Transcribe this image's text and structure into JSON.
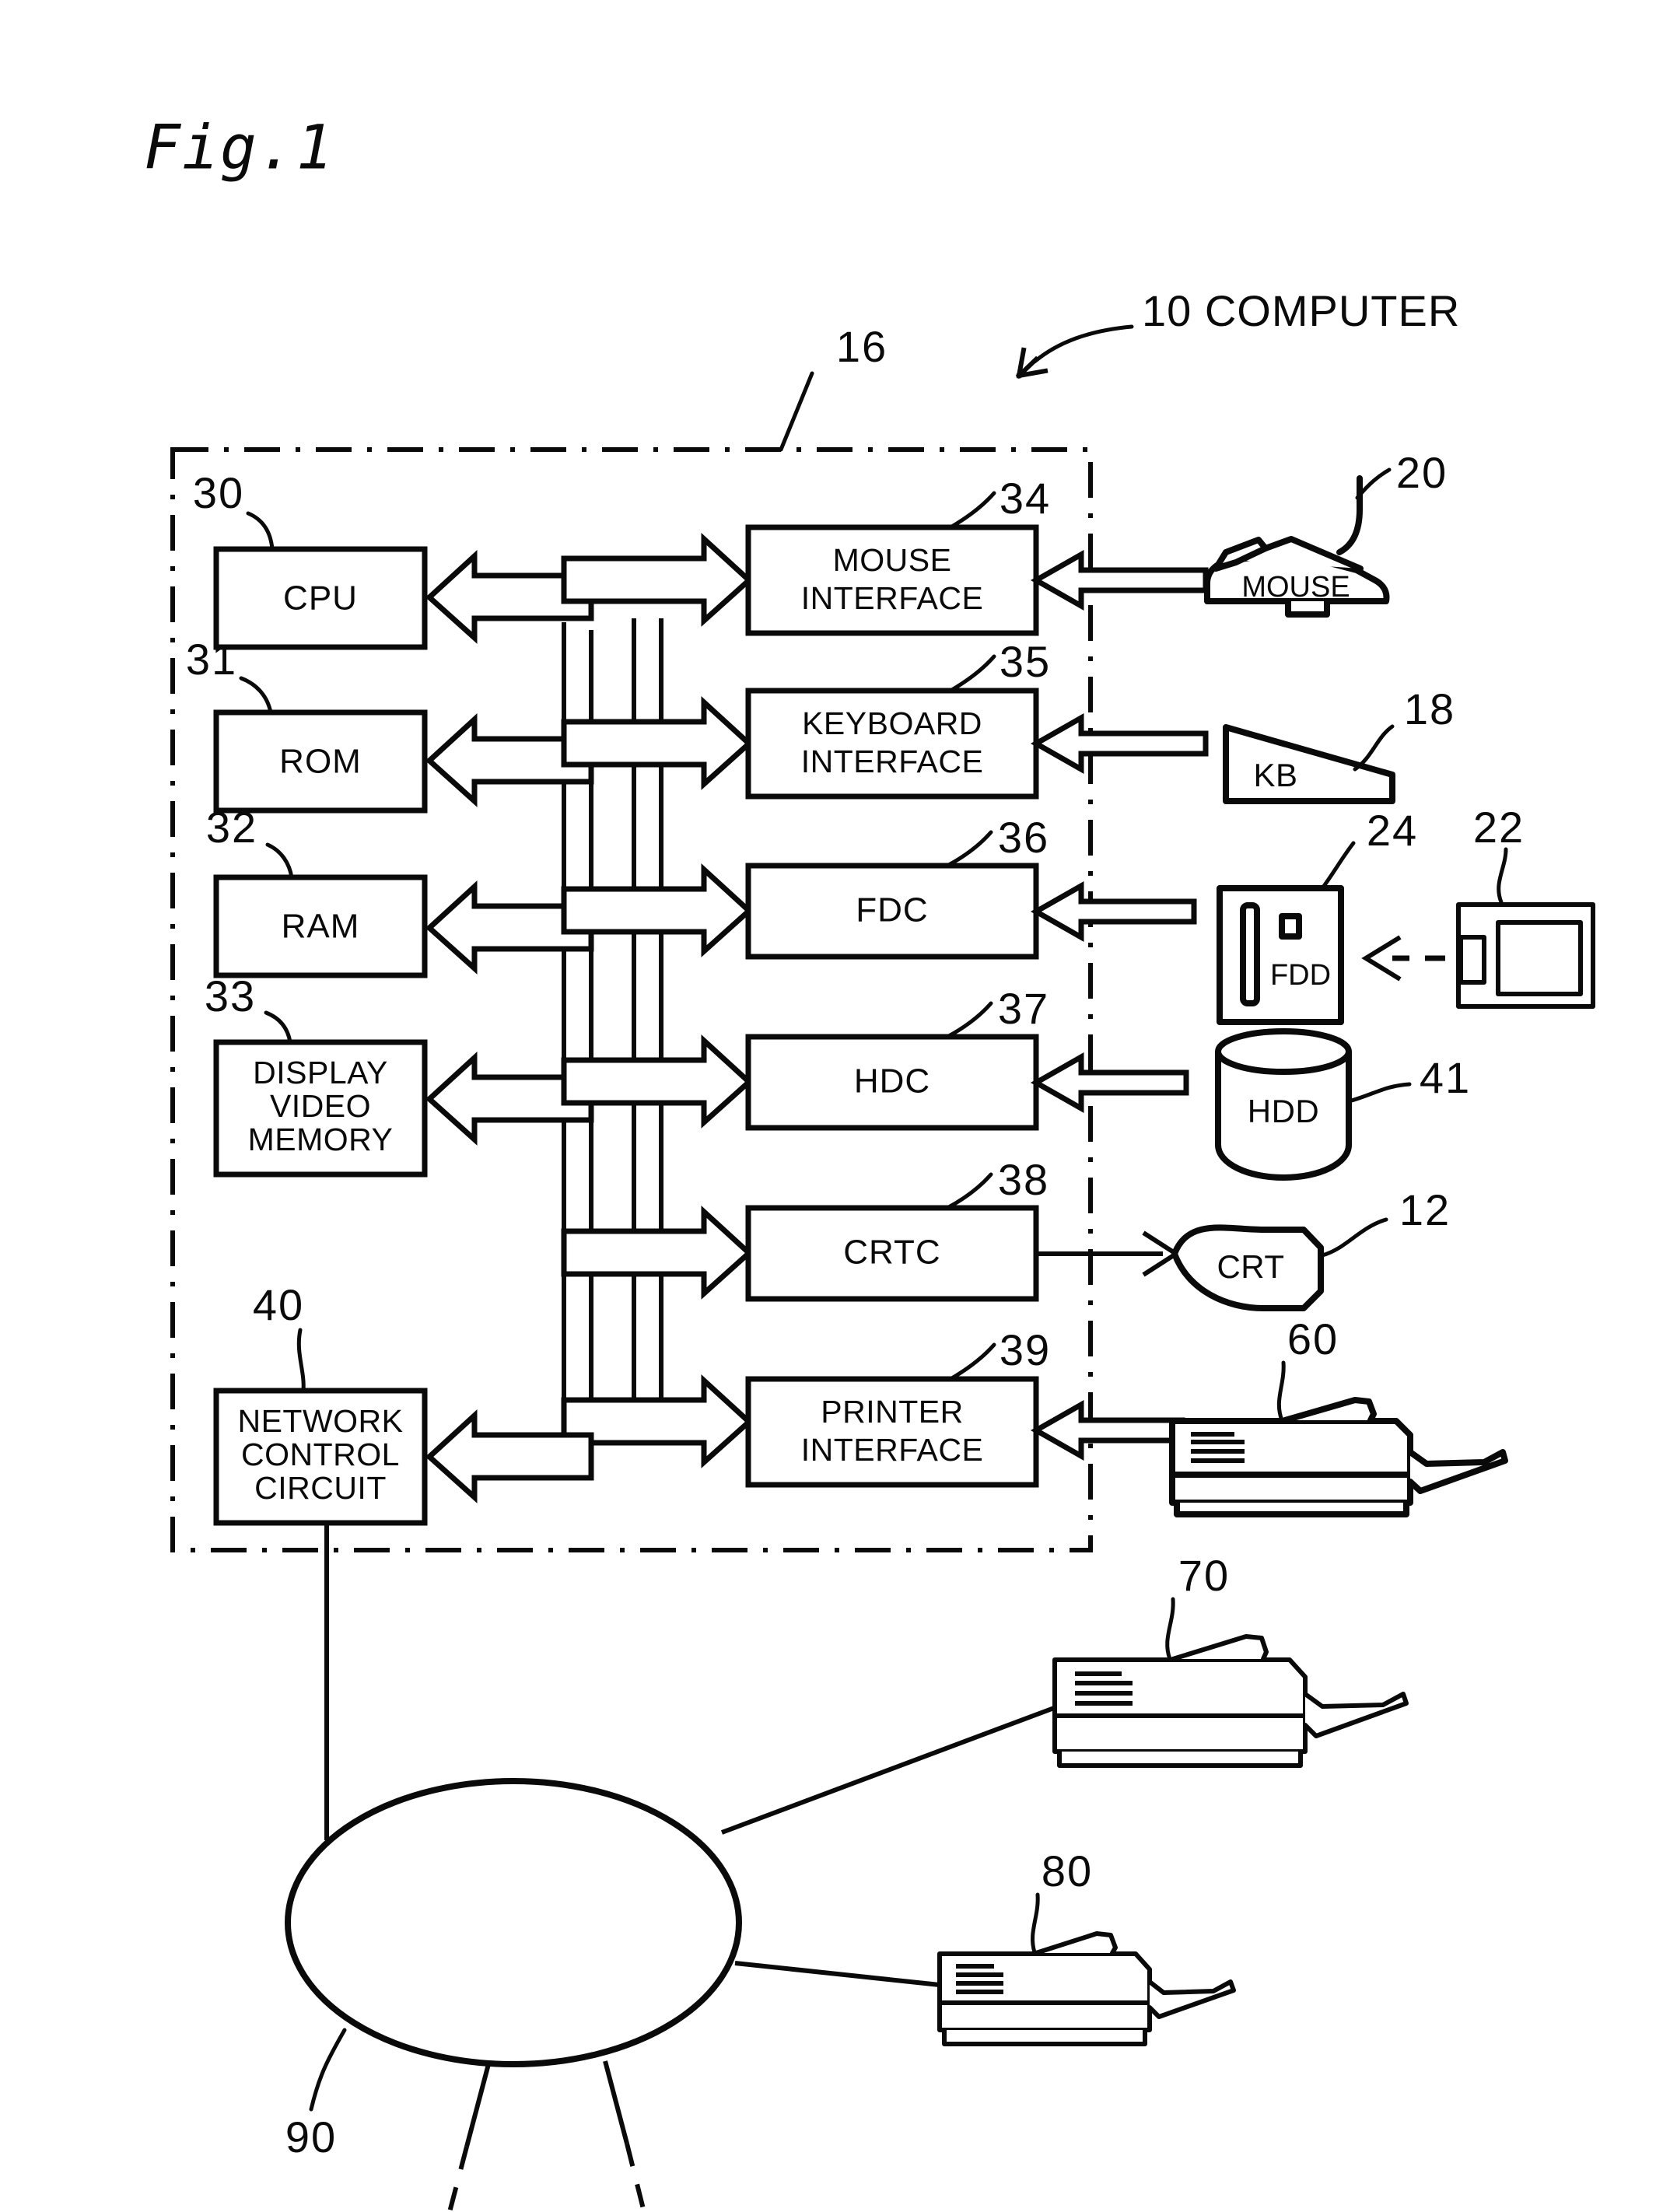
{
  "figure": {
    "title": "Fig.1",
    "callout": {
      "ref": "10",
      "label": "10 COMPUTER"
    },
    "enclosure_ref": "16"
  },
  "internal_blocks": [
    {
      "ref": "30",
      "label": "CPU",
      "lines": [
        "CPU"
      ]
    },
    {
      "ref": "31",
      "label": "ROM",
      "lines": [
        "ROM"
      ]
    },
    {
      "ref": "32",
      "label": "RAM",
      "lines": [
        "RAM"
      ]
    },
    {
      "ref": "33",
      "label": "DISPLAY VIDEO MEMORY",
      "lines": [
        "DISPLAY",
        "VIDEO",
        "MEMORY"
      ]
    },
    {
      "ref": "40",
      "label": "NETWORK CONTROL CIRCUIT",
      "lines": [
        "NETWORK",
        "CONTROL",
        "CIRCUIT"
      ]
    }
  ],
  "interface_blocks": [
    {
      "ref": "34",
      "label": "MOUSE INTERFACE",
      "lines": [
        "MOUSE",
        "INTERFACE"
      ]
    },
    {
      "ref": "35",
      "label": "KEYBOARD INTERFACE",
      "lines": [
        "KEYBOARD",
        "INTERFACE"
      ]
    },
    {
      "ref": "36",
      "label": "FDC",
      "lines": [
        "FDC"
      ]
    },
    {
      "ref": "37",
      "label": "HDC",
      "lines": [
        "HDC"
      ]
    },
    {
      "ref": "38",
      "label": "CRTC",
      "lines": [
        "CRTC"
      ]
    },
    {
      "ref": "39",
      "label": "PRINTER INTERFACE",
      "lines": [
        "PRINTER",
        "INTERFACE"
      ]
    }
  ],
  "peripherals": [
    {
      "ref": "20",
      "label": "MOUSE",
      "shape": "mouse"
    },
    {
      "ref": "18",
      "label": "KB",
      "shape": "keyboard"
    },
    {
      "ref": "24",
      "label": "FDD",
      "shape": "floppy-drive"
    },
    {
      "ref": "22",
      "label": "",
      "shape": "floppy-disk"
    },
    {
      "ref": "41",
      "label": "HDD",
      "shape": "cylinder"
    },
    {
      "ref": "12",
      "label": "CRT",
      "shape": "crt-tube"
    },
    {
      "ref": "60",
      "label": "",
      "shape": "printer"
    }
  ],
  "network": {
    "ref": "90",
    "label": "",
    "shape": "ellipse",
    "attached_printers": [
      {
        "ref": "70",
        "shape": "printer"
      },
      {
        "ref": "80",
        "shape": "printer"
      }
    ]
  },
  "colors": {
    "ink": "#0a0a0a",
    "paper": "#ffffff"
  }
}
